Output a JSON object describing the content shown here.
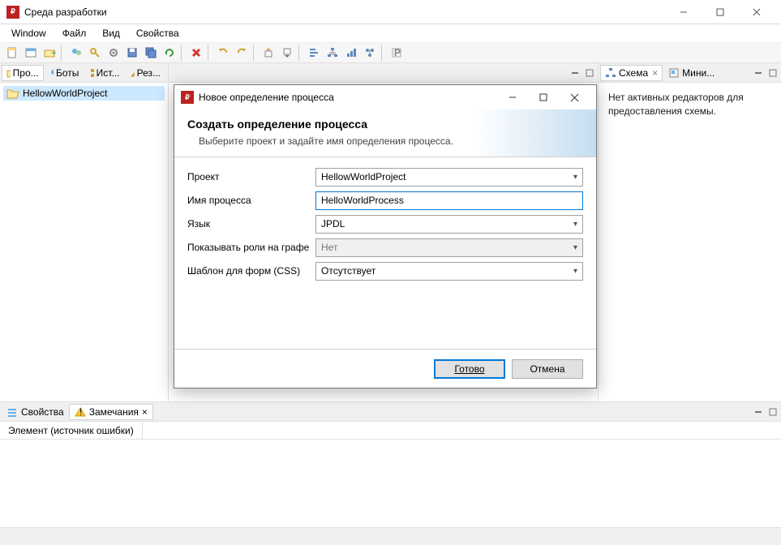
{
  "window": {
    "title": "Среда разработки"
  },
  "menu": {
    "items": [
      "Window",
      "Файл",
      "Вид",
      "Свойства"
    ]
  },
  "left": {
    "tabs": [
      {
        "label": "Про..."
      },
      {
        "label": "Боты"
      },
      {
        "label": "Ист..."
      },
      {
        "label": "Рез..."
      }
    ],
    "tree": {
      "project": "HellowWorldProject"
    }
  },
  "right": {
    "tabs": [
      {
        "label": "Схема"
      },
      {
        "label": "Мини..."
      }
    ],
    "message": "Нет активных редакторов для предоставления схемы."
  },
  "bottom": {
    "tabs": [
      {
        "label": "Свойства"
      },
      {
        "label": "Замечания"
      }
    ],
    "column_header": "Элемент (источник ошибки)"
  },
  "dialog": {
    "title": "Новое определение процесса",
    "banner_title": "Создать определение процесса",
    "banner_desc": "Выберите проект и задайте имя определения процесса.",
    "fields": {
      "project": {
        "label": "Проект",
        "value": "HellowWorldProject"
      },
      "name": {
        "label": "Имя процесса",
        "value": "HelloWorldProcess"
      },
      "lang": {
        "label": "Язык",
        "value": "JPDL"
      },
      "roles": {
        "label": "Показывать роли на графе",
        "value": "Нет"
      },
      "css": {
        "label": "Шаблон для форм (CSS)",
        "value": "Отсутствует"
      }
    },
    "buttons": {
      "finish": "Готово",
      "cancel": "Отмена"
    }
  }
}
